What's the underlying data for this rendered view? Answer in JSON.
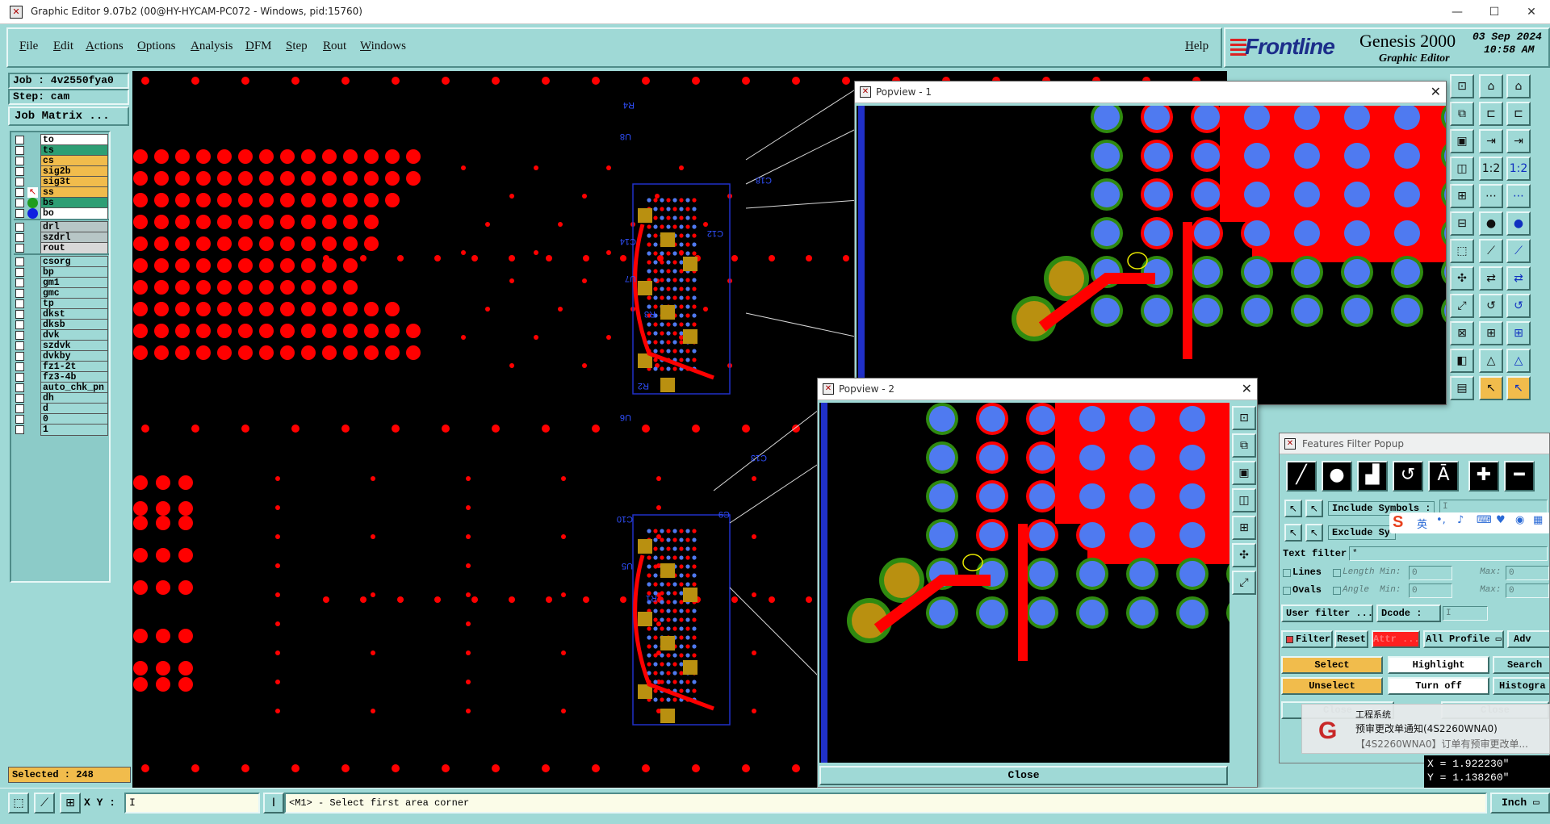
{
  "window": {
    "title": "Graphic Editor 9.07b2 (00@HY-HYCAM-PC072 - Windows, pid:15760)",
    "minimize": "—",
    "maximize": "☐",
    "close": "✕"
  },
  "menu": {
    "items": [
      "File",
      "Edit",
      "Actions",
      "Options",
      "Analysis",
      "DFM",
      "Step",
      "Rout",
      "Windows"
    ],
    "help": "Help"
  },
  "logo": {
    "brand": "Frontline",
    "product": "Genesis 2000",
    "subtitle": "Graphic Editor",
    "date": "03 Sep 2024",
    "time": "10:58 AM"
  },
  "job": {
    "job_line": "Job : 4v2550fya0",
    "step_line": "Step: cam",
    "matrix_button": "Job Matrix ..."
  },
  "layers": {
    "group1": [
      {
        "name": "to",
        "color": "#ffffff",
        "marker": ""
      },
      {
        "name": "ts",
        "color": "#2e9e74",
        "marker": ""
      },
      {
        "name": "cs",
        "color": "#f1bc4c",
        "marker": ""
      },
      {
        "name": "sig2b",
        "color": "#f1bc4c",
        "marker": ""
      },
      {
        "name": "sig3t",
        "color": "#f1bc4c",
        "marker": ""
      },
      {
        "name": "ss",
        "color": "#f1bc4c",
        "marker": "cursor",
        "suffix": "≡"
      },
      {
        "name": "bs",
        "color": "#2e9e74",
        "marker": "green"
      },
      {
        "name": "bo",
        "color": "#ffffff",
        "marker": "blue"
      }
    ],
    "group2": [
      {
        "name": "drl",
        "color": "#b7c6c6"
      },
      {
        "name": "szdrl",
        "color": "#b7c6c6"
      },
      {
        "name": "rout",
        "color": "#d8d8d8"
      }
    ],
    "group3": [
      {
        "name": "csorg"
      },
      {
        "name": "bp"
      },
      {
        "name": "gm1"
      },
      {
        "name": "gmc"
      },
      {
        "name": "tp"
      },
      {
        "name": "dkst"
      },
      {
        "name": "dksb"
      },
      {
        "name": "dvk"
      },
      {
        "name": "szdvk"
      },
      {
        "name": "dvkby"
      },
      {
        "name": "fz1-2t"
      },
      {
        "name": "fz3-4b"
      },
      {
        "name": "auto_chk_pn"
      },
      {
        "name": "dh"
      },
      {
        "name": "d"
      },
      {
        "name": "0"
      },
      {
        "name": "1"
      }
    ]
  },
  "selected": "Selected : 248",
  "canvas": {
    "component_labels": [
      "R4",
      "U8",
      "C18",
      "C14",
      "C12",
      "U7",
      "R3",
      "R2",
      "U6",
      "C13",
      "C10",
      "C9",
      "U5",
      "R1"
    ]
  },
  "popview1": {
    "title": "Popview - 1"
  },
  "popview2": {
    "title": "Popview - 2",
    "close_button": "Close"
  },
  "features_filter": {
    "title": "Features Filter Popup",
    "include_label": "Include Symbols :",
    "exclude_label": "Exclude Sy",
    "text_filter_label": "Text filter",
    "text_filter_value": "*",
    "lines_label": "Lines",
    "ovals_label": "Ovals",
    "length_label": "Length",
    "angle_label": "Angle",
    "min_label": "Min:",
    "max_label": "Max:",
    "zero": "0",
    "user_filter_button": "User filter ...",
    "dcode_button": "Dcode :",
    "filter_label": "Filter",
    "reset_button": "Reset",
    "attr_button": "Attr ...",
    "profile_option": "All Profile",
    "adv_button": "Adv",
    "select_button": "Select",
    "highlight_button": "Highlight",
    "search_button": "Search",
    "unselect_button": "Unselect",
    "turnoff_button": "Turn off",
    "histogram_button": "Histogra",
    "close_button": "Close",
    "ime_label": "英"
  },
  "notification": {
    "app": "工程系统",
    "title": "预审更改单通知(4S2260WNA0)",
    "body": "【4S2260WNA0】订单有预审更改单..."
  },
  "coords": {
    "x": "X = 1.922230\"",
    "y": "Y = 1.138260\""
  },
  "status": {
    "xy_label": "X Y :",
    "prompt": "<M1> - Select first area corner",
    "units": "Inch"
  },
  "colors": {
    "panel": "#9fd9d6",
    "pad_red": "#ff0000",
    "pad_blue": "#4f7af0",
    "pad_green": "#2f8a10",
    "pad_gold": "#b99010",
    "selection_blue": "#2030c8"
  }
}
